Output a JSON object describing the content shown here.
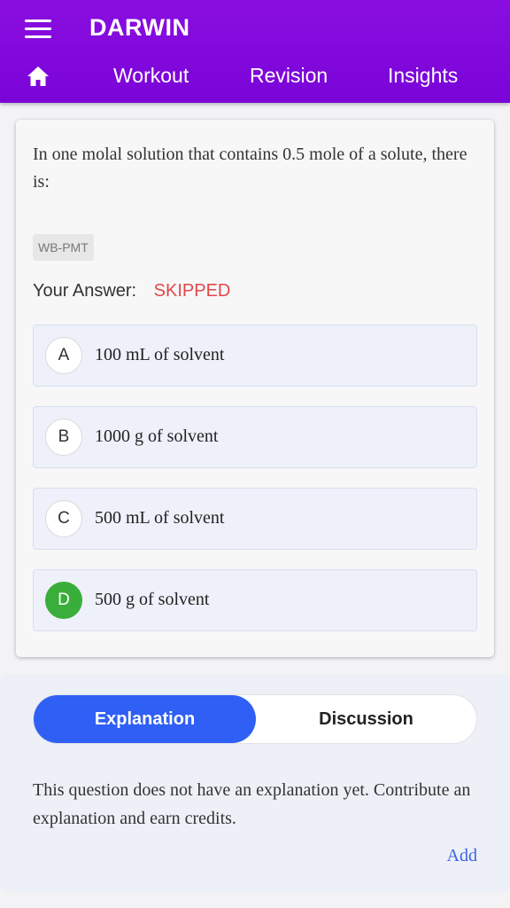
{
  "header": {
    "app_title": "DARWIN",
    "nav": [
      {
        "label": "Workout"
      },
      {
        "label": "Revision"
      },
      {
        "label": "Insights"
      }
    ],
    "icons": {
      "menu": "menu-icon",
      "home": "home-icon"
    },
    "accent": "#7d06da"
  },
  "question": {
    "text": "In one molal solution that contains 0.5 mole of a solute, there is:",
    "tag": "WB-PMT",
    "answer_label": "Your Answer:",
    "answer_value": "SKIPPED",
    "answer_color": "#e0474c",
    "options": [
      {
        "letter": "A",
        "text": "100 mL of solvent",
        "correct": false
      },
      {
        "letter": "B",
        "text": "1000 g of solvent",
        "correct": false
      },
      {
        "letter": "C",
        "text": "500 mL of solvent",
        "correct": false
      },
      {
        "letter": "D",
        "text": "500 g of solvent",
        "correct": true
      }
    ],
    "correct_color": "#3aae3a"
  },
  "explanation": {
    "tabs": [
      {
        "label": "Explanation",
        "active": true
      },
      {
        "label": "Discussion",
        "active": false
      }
    ],
    "message": "This question does not have an explanation yet. Contribute an explanation and earn credits.",
    "add_label": "Add",
    "active_color": "#2f5ff5"
  }
}
